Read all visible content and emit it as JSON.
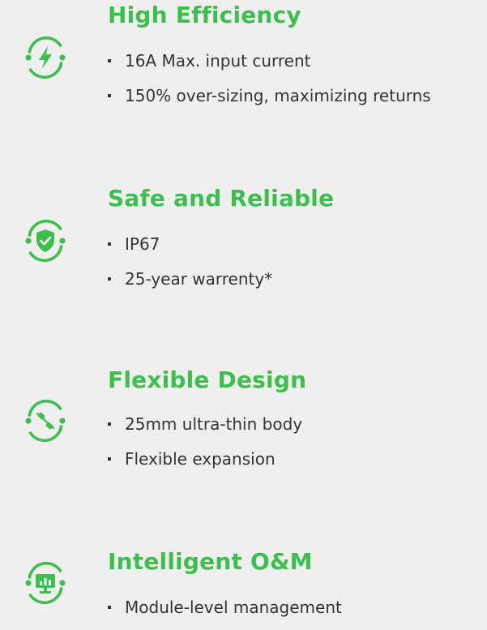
{
  "colors": {
    "accent": "#3cbf4d",
    "text": "#333333",
    "background": "#efefef"
  },
  "features": [
    {
      "icon": "lightning-bolt-icon",
      "title": "High Efficiency",
      "bullets": [
        "16A Max. input current",
        "150% over-sizing, maximizing returns"
      ]
    },
    {
      "icon": "shield-check-icon",
      "title": "Safe and Reliable",
      "bullets": [
        "IP67",
        "25-year warrenty*"
      ]
    },
    {
      "icon": "flexible-connector-icon",
      "title": "Flexible Design",
      "bullets": [
        "25mm ultra-thin body",
        "Flexible expansion"
      ]
    },
    {
      "icon": "monitor-chart-icon",
      "title": "Intelligent O&M",
      "bullets": [
        "Module-level management"
      ]
    }
  ]
}
